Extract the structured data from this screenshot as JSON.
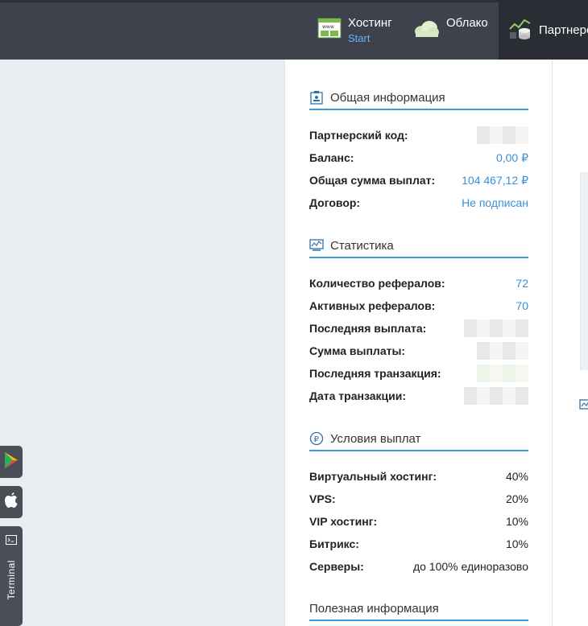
{
  "topnav": {
    "hosting": {
      "label": "Хостинг",
      "sub": "Start"
    },
    "cloud": {
      "label": "Облако"
    },
    "partner": {
      "label": "Партнерс"
    }
  },
  "sidebar_buttons": {
    "terminal_label": "Terminal"
  },
  "general": {
    "title": "Общая информация",
    "rows": [
      {
        "k": "Партнерский код:",
        "v": ""
      },
      {
        "k": "Баланс:",
        "v": "0,00 ₽"
      },
      {
        "k": "Общая сумма выплат:",
        "v": "104 467,12 ₽"
      },
      {
        "k": "Договор:",
        "v": "Не подписан"
      }
    ]
  },
  "stats": {
    "title": "Статистика",
    "rows": [
      {
        "k": "Количество рефералов:",
        "v": "72"
      },
      {
        "k": "Активных рефералов:",
        "v": "70"
      },
      {
        "k": "Последняя выплата:",
        "v": ""
      },
      {
        "k": "Сумма выплаты:",
        "v": ""
      },
      {
        "k": "Последняя транзакция:",
        "v": ""
      },
      {
        "k": "Дата транзакции:",
        "v": ""
      }
    ]
  },
  "payouts": {
    "title": "Условия выплат",
    "rows": [
      {
        "k": "Виртуальный хостинг:",
        "v": "40%"
      },
      {
        "k": "VPS:",
        "v": "20%"
      },
      {
        "k": "VIP хостинг:",
        "v": "10%"
      },
      {
        "k": "Битрикс:",
        "v": "10%"
      },
      {
        "k": "Серверы:",
        "v": "до 100% единоразово"
      }
    ]
  },
  "useful": {
    "title": "Полезная информация"
  },
  "colors": {
    "accent": "#3a9ad9",
    "link": "#3a8fd6",
    "topbar": "#3d424d"
  }
}
